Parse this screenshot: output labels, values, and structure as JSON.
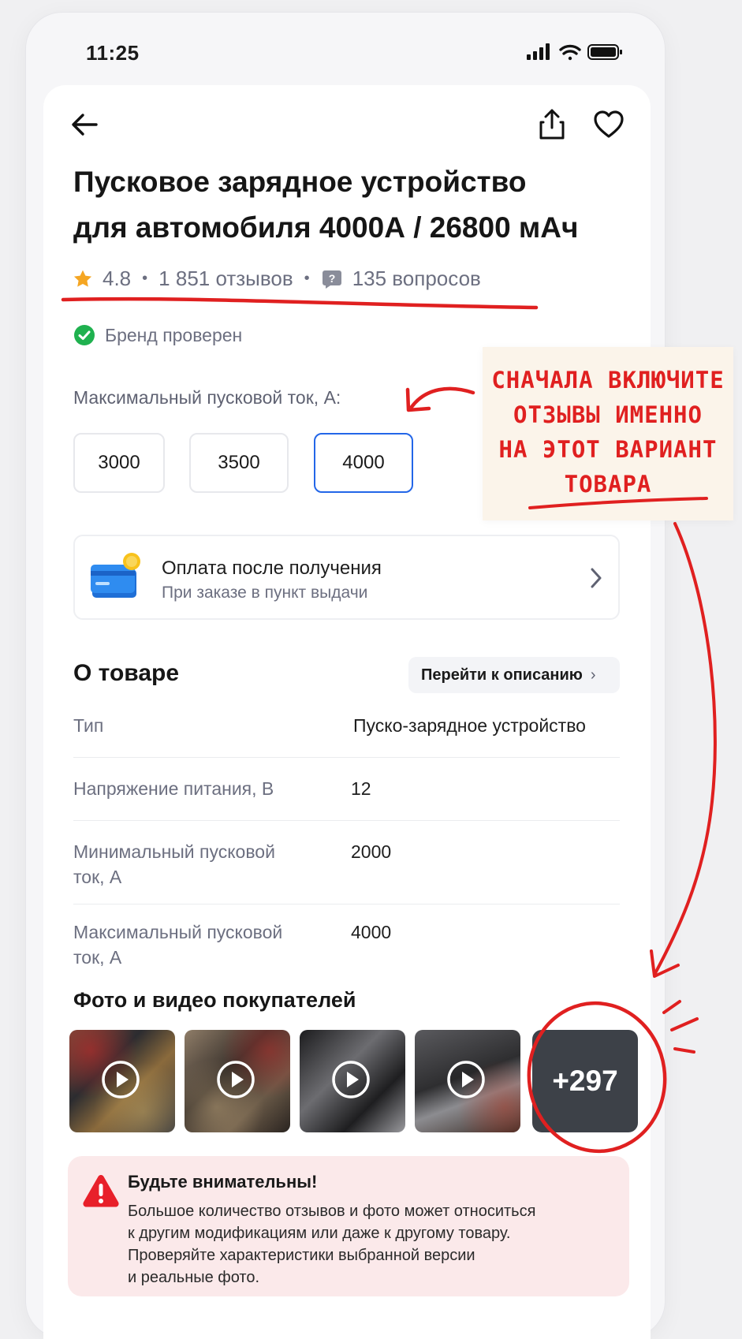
{
  "status_bar": {
    "time": "11:25"
  },
  "product": {
    "title_line1": "Пусковое зарядное устройство",
    "title_line2": "для автомобиля 4000А / 26800 мАч",
    "rating": "4.8",
    "reviews": "1 851 отзывов",
    "questions": "135 вопросов",
    "brand_status": "Бренд проверен"
  },
  "variant": {
    "label": "Максимальный пусковой ток, А:",
    "options": [
      "3000",
      "3500",
      "4000"
    ],
    "selected": "4000"
  },
  "payment": {
    "title": "Оплата после получения",
    "subtitle": "При заказе в пункт выдачи"
  },
  "about": {
    "title": "О товаре",
    "link_label": "Перейти к описанию",
    "specs": [
      {
        "label": "Тип",
        "value": "Пуско-зарядное устройство"
      },
      {
        "label": "Напряжение питания, В",
        "value": "12"
      },
      {
        "label": "Минимальный пусковой ток, А",
        "value": "2000"
      },
      {
        "label": "Максимальный пусковой ток, А",
        "value": "4000"
      }
    ]
  },
  "photos": {
    "title": "Фото и видео покупателей",
    "more_count": "+297"
  },
  "warning": {
    "title": "Будьте внимательны!",
    "lines": [
      "Большое количество отзывов и фото может относиться",
      "к другим модификациям или даже к другому товару.",
      "Проверяйте характеристики выбранной версии",
      "и реальные фото."
    ]
  },
  "annotation": {
    "lines": [
      "СНАЧАЛА ВКЛЮЧИТЕ",
      "ОТЗЫВЫ ИМЕННО",
      "НА ЭТОТ ВАРИАНТ",
      "ТОВАРА"
    ]
  },
  "colors": {
    "accent_blue": "#2366e8",
    "annotation_red": "#e02020",
    "star": "#f5a623",
    "brand_check": "#1fb14f",
    "warning_bg": "#fbe9ea",
    "warning_icon": "#e8202a"
  }
}
